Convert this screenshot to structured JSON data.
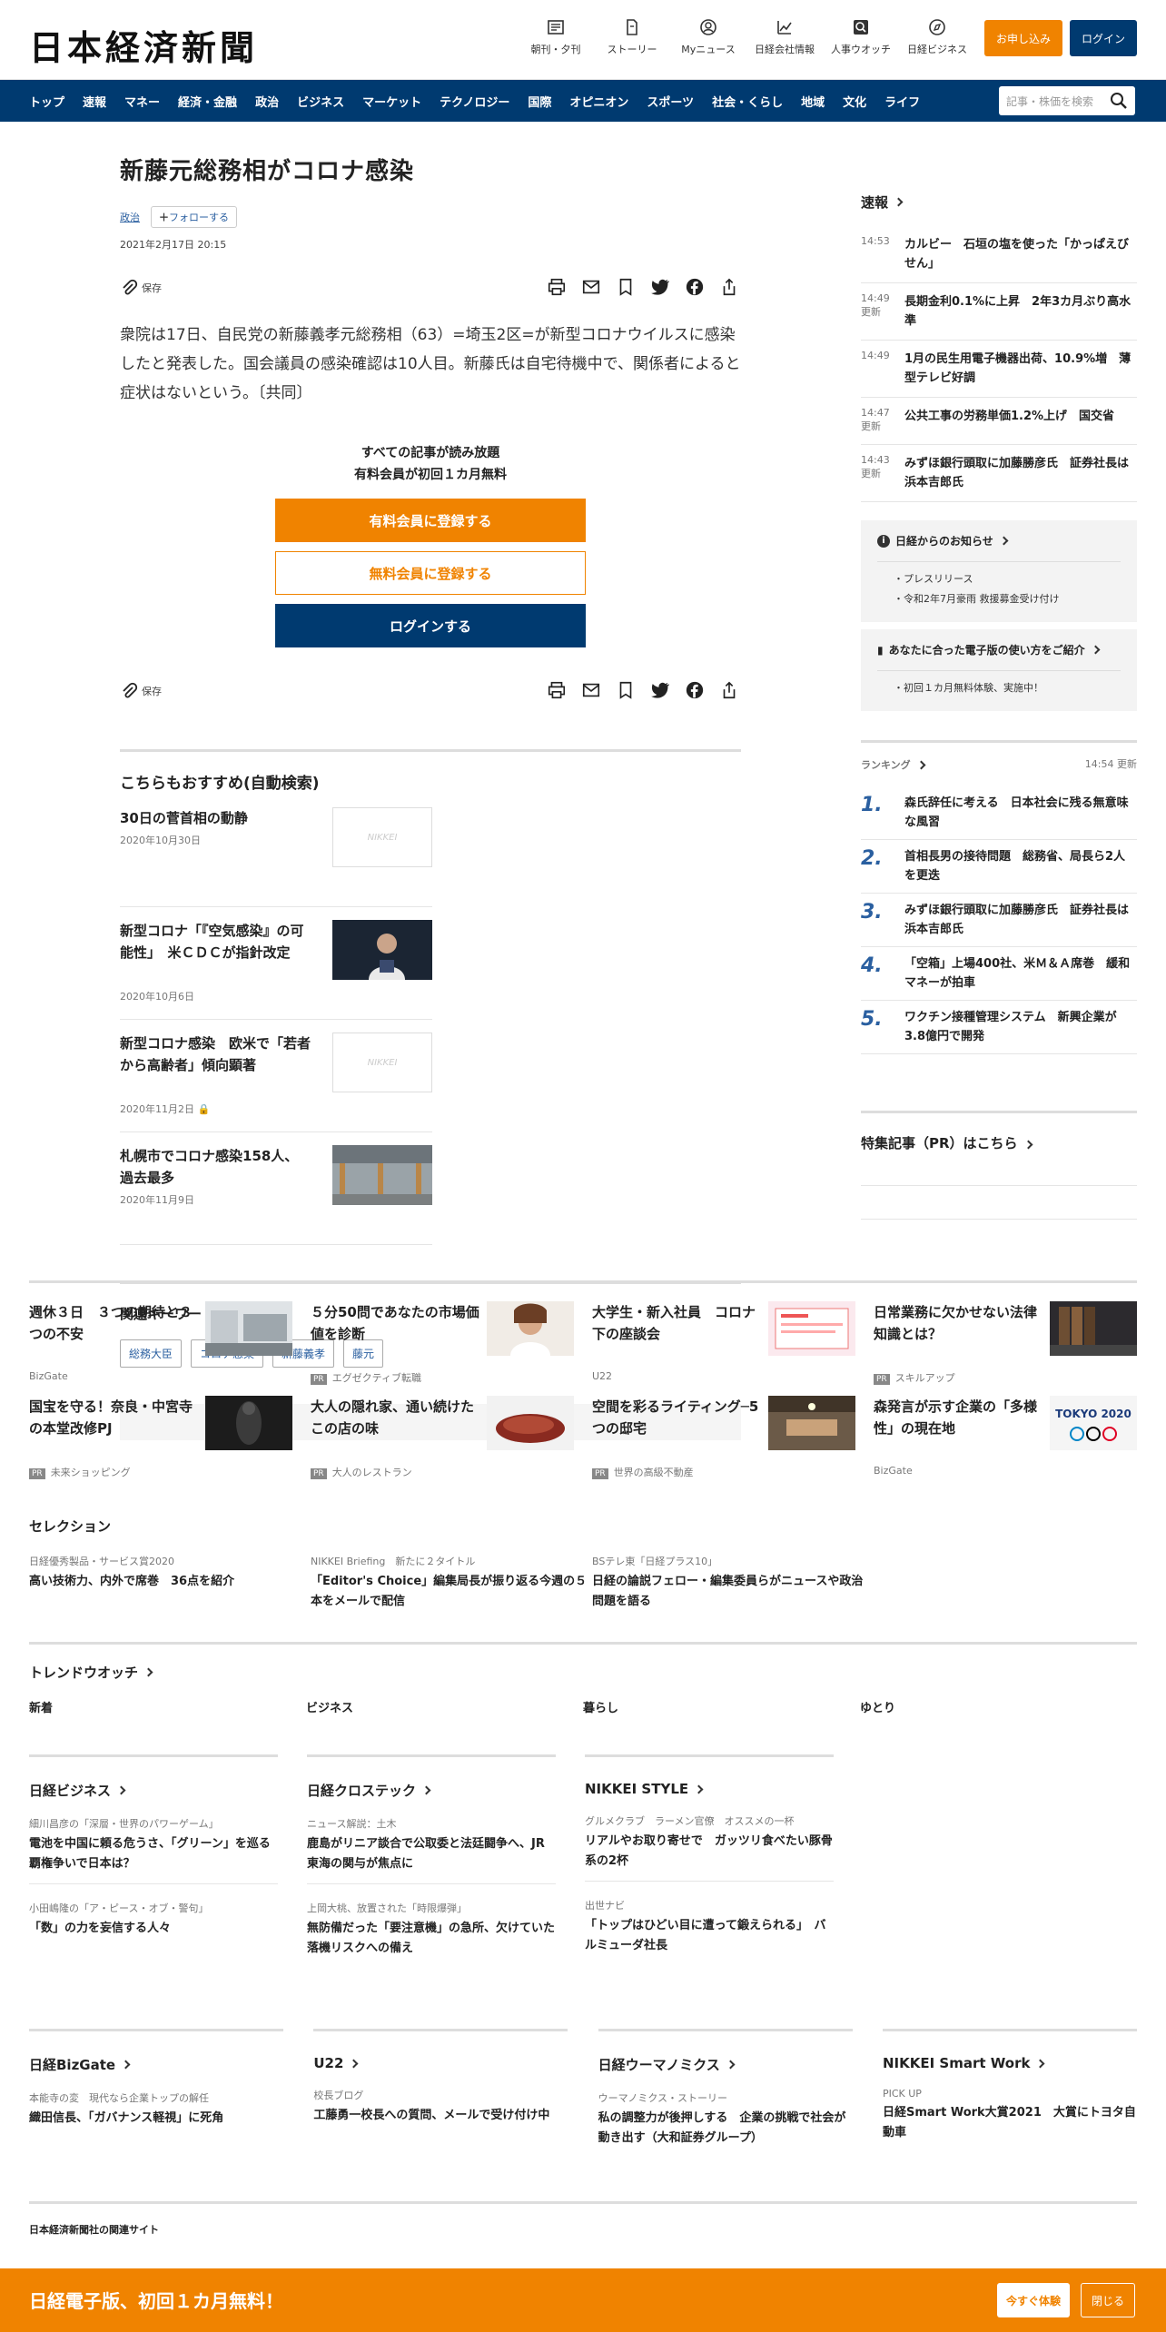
{
  "header": {
    "logo": "日本経済新聞",
    "nav": [
      {
        "label": "朝刊・夕刊",
        "icon": "newspaper-icon"
      },
      {
        "label": "ストーリー",
        "icon": "document-icon"
      },
      {
        "label": "Myニュース",
        "icon": "user-icon"
      },
      {
        "label": "日経会社情報",
        "icon": "chart-icon"
      },
      {
        "label": "人事ウオッチ",
        "icon": "search-person-icon"
      },
      {
        "label": "日経ビジネス",
        "icon": "compass-icon"
      }
    ],
    "signup_label": "お申し込み",
    "login_label": "ログイン"
  },
  "gnav": {
    "items": [
      "トップ",
      "速報",
      "マネー",
      "経済・金融",
      "政治",
      "ビジネス",
      "マーケット",
      "テクノロジー",
      "国際",
      "オピニオン",
      "スポーツ",
      "社会・くらし",
      "地域",
      "文化",
      "ライフ"
    ],
    "search_placeholder": "記事・株価を検索"
  },
  "article": {
    "title": "新藤元総務相がコロナ感染",
    "category": "政治",
    "follow_label": "フォローする",
    "date": "2021年2月17日 20:15",
    "save_label": "保存",
    "body": "衆院は17日、自民党の新藤義孝元総務相（63）=埼玉2区=が新型コロナウイルスに感染したと発表した。国会議員の感染確認は10人目。新藤氏は自宅待機中で、関係者によると症状はないという。〔共同〕"
  },
  "paywall": {
    "line1": "すべての記事が読み放題",
    "line2": "有料会員が初回１カ月無料",
    "paid_label": "有料会員に登録する",
    "free_label": "無料会員に登録する",
    "login_label": "ログインする"
  },
  "recommend": {
    "title": "こちらもおすすめ(自動検索)",
    "items": [
      {
        "title": "30日の菅首相の動静",
        "date": "2020年10月30日"
      },
      {
        "title": "新型コロナ「『空気感染』の可能性」　米ＣＤＣが指針改定",
        "date": "2020年10月6日"
      },
      {
        "title": "新型コロナ感染　欧米で「若者から高齢者」傾向顕著",
        "date": "2020年11月2日"
      },
      {
        "title": "札幌市でコロナ感染158人、過去最多",
        "date": "2020年11月9日"
      }
    ],
    "placeholder_logo": "NIKKEI"
  },
  "keywords": {
    "title": "関連キーワード",
    "items": [
      "総務大臣",
      "コロナ感染",
      "新藤義孝",
      "藤元"
    ]
  },
  "sokuho": {
    "title": "速報",
    "update_label": "更新",
    "items": [
      {
        "time": "14:53",
        "text": "カルビー　石垣の塩を使った「かっぱえびせん」",
        "updated": false
      },
      {
        "time": "14:49",
        "text": "長期金利0.1%に上昇　2年3カ月ぶり高水準",
        "updated": true
      },
      {
        "time": "14:49",
        "text": "1月の民生用電子機器出荷、10.9%増　薄型テレビ好調",
        "updated": false
      },
      {
        "time": "14:47",
        "text": "公共工事の労務単価1.2%上げ　国交省",
        "updated": true
      },
      {
        "time": "14:43",
        "text": "みずほ銀行頭取に加藤勝彦氏　証券社長は浜本吉郎氏",
        "updated": true
      }
    ]
  },
  "notice": {
    "title": "日経からのお知らせ",
    "items": [
      "プレスリリース",
      "令和2年7月豪雨 救援募金受け付け"
    ]
  },
  "guide": {
    "title": "あなたに合った電子版の使い方をご紹介",
    "items": [
      "初回１カ月無料体験、実施中！"
    ]
  },
  "ranking": {
    "title": "ランキング",
    "time": "14:54 更新",
    "items": [
      {
        "num": "1.",
        "text": "森氏辞任に考える　日本社会に残る無意味な風習"
      },
      {
        "num": "2.",
        "text": "首相長男の接待問題　総務省、局長ら2人を更迭"
      },
      {
        "num": "3.",
        "text": "みずほ銀行頭取に加藤勝彦氏　証券社長は浜本吉郎氏"
      },
      {
        "num": "4.",
        "text": "「空箱」上場400社、米Ｍ＆Ａ席巻　緩和マネーが拍車"
      },
      {
        "num": "5.",
        "text": "ワクチン接種管理システム　新興企業が3.8億円で開発"
      }
    ]
  },
  "pr": {
    "title": "特集記事（PR）はこちら"
  },
  "ads": {
    "pr_badge": "PR",
    "items": [
      {
        "title": "週休３日　３つの期待と３つの不安",
        "source": "BizGate",
        "pr": false
      },
      {
        "title": "５分50問であなたの市場価値を診断",
        "source": "エグゼクティブ転職",
        "pr": true
      },
      {
        "title": "大学生・新入社員　コロナ下の座談会",
        "source": "U22",
        "pr": false
      },
      {
        "title": "日常業務に欠かせない法律知識とは？",
        "source": "スキルアップ",
        "pr": true
      },
      {
        "title": "国宝を守る！奈良・中宮寺の本堂改修PJ",
        "source": "未来ショッピング",
        "pr": true
      },
      {
        "title": "大人の隠れ家、通い続けたこの店の味",
        "source": "大人のレストラン",
        "pr": true
      },
      {
        "title": "空間を彩るライティング─5つの邸宅",
        "source": "世界の高級不動産",
        "pr": true
      },
      {
        "title": "森発言が示す企業の「多様性」の現在地",
        "source": "BizGate",
        "pr": false
      }
    ],
    "tokyo_label": "TOKYO 2020"
  },
  "selection": {
    "title": "セレクション",
    "items": [
      {
        "label": "日経優秀製品・サービス賞2020",
        "text": "高い技術力、内外で席巻　36点を紹介"
      },
      {
        "label": "NIKKEI Briefing　新たに２タイトル",
        "text": "「Editor's Choice」編集局長が振り返る今週の５本をメールで配信"
      },
      {
        "label": "BSテレ東「日経プラス10」",
        "text": "日経の論説フェロー・編集委員らがニュースや政治問題を語る"
      }
    ]
  },
  "trend": {
    "title": "トレンドウオッチ",
    "tabs": [
      "新着",
      "ビジネス",
      "暮らし",
      "ゆとり"
    ]
  },
  "media": [
    {
      "title": "日経ビジネス",
      "items": [
        {
          "label": "細川昌彦の「深層・世界のパワーゲーム」",
          "text": "電池を中国に頼る危うさ、「グリーン」を巡る覇権争いで日本は？"
        },
        {
          "label": "小田嶋隆の「ア・ピース・オブ・警句」",
          "text": "「数」の力を妄信する人々"
        }
      ]
    },
    {
      "title": "日経クロステック",
      "items": [
        {
          "label": "ニュース解説：土木",
          "text": "鹿島がリニア談合で公取委と法廷闘争へ、JR東海の関与が焦点に"
        },
        {
          "label": "上岡大桃、放置された「時限爆弾」",
          "text": "無防備だった「要注意機」の急所、欠けていた落機リスクへの備え"
        }
      ]
    },
    {
      "title": "NIKKEI STYLE",
      "items": [
        {
          "label": "グルメクラブ　ラーメン官僚　オススメの一杯",
          "text": "リアルやお取り寄せで　ガッツリ食べたい豚骨系の2杯"
        },
        {
          "label": "出世ナビ",
          "text": "「トップはひどい目に遭って鍛えられる」　バルミューダ社長"
        }
      ]
    }
  ],
  "media2": [
    {
      "title": "日経BizGate",
      "label": "本能寺の変　現代なら企業トップの解任",
      "text": "織田信長、「ガバナンス軽視」に死角"
    },
    {
      "title": "U22",
      "label": "校長ブログ",
      "text": "工藤勇一校長への質問、メールで受け付け中"
    },
    {
      "title": "日経ウーマノミクス",
      "label": "ウーマノミクス・ストーリー",
      "text": "私の調整力が後押しする　企業の挑戦で社会が動き出す（大和証券グループ）"
    },
    {
      "title": "NIKKEI Smart Work",
      "label": "PICK UP",
      "text": "日経Smart Work大賞2021　大賞にトヨタ自動車"
    }
  ],
  "related": {
    "title": "日本経済新聞社の関連サイト"
  },
  "banner": {
    "text": "日経電子版、初回１カ月無料！",
    "try_label": "今すぐ体験",
    "close_label": "閉じる"
  },
  "colors": {
    "navy": "#003a70",
    "orange": "#f08300",
    "link": "#2a5fa0"
  }
}
